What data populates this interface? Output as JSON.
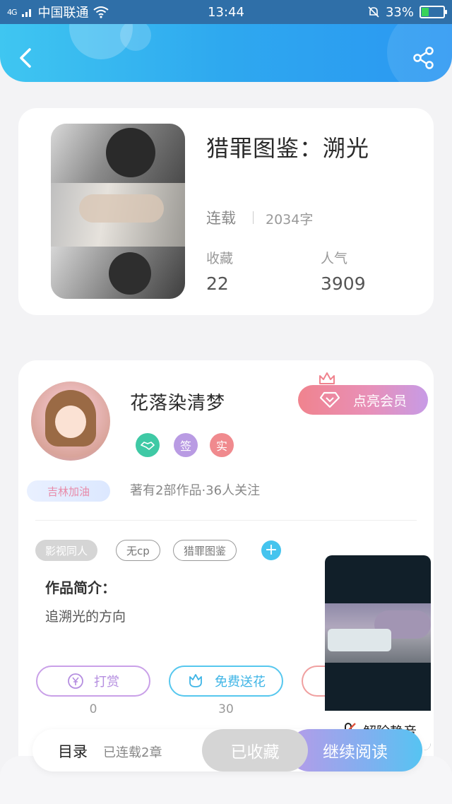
{
  "status_bar": {
    "network": "4G",
    "carrier": "中国联通",
    "time": "13:44",
    "battery": "33%",
    "battery_level": 0.33
  },
  "header": {
    "back_icon": "chevron-left-icon",
    "share_icon": "share-icon"
  },
  "book": {
    "title": "猎罪图鉴：溯光",
    "status": "连载",
    "words": "2034字",
    "favorites_label": "收藏",
    "favorites_value": "22",
    "popularity_label": "人气",
    "popularity_value": "3909"
  },
  "author": {
    "name": "花落染清梦",
    "vip_label": "点亮会员",
    "badges": [
      "签",
      "实"
    ],
    "region": "吉林加油",
    "meta": "著有2部作品·36人关注"
  },
  "tags": [
    "影视同人",
    "无cp",
    "猎罪图鉴"
  ],
  "intro": {
    "title": "作品简介：",
    "text": "追溯光的方向"
  },
  "actions": {
    "tip_label": "打赏",
    "tip_count": "0",
    "flower_label": "免费送花",
    "flower_count": "30"
  },
  "video": {
    "unmute_label": "解除静音"
  },
  "bottom_bar": {
    "toc_label": "目录",
    "chapters_label": "已连载2章",
    "collected_label": "已收藏",
    "continue_label": "继续阅读"
  },
  "colors": {
    "accent": "#2ea8ef",
    "vip_start": "#f0838e",
    "vip_end": "#c79be6",
    "tip_border": "#c79be6",
    "flower_border": "#45c4ee"
  }
}
